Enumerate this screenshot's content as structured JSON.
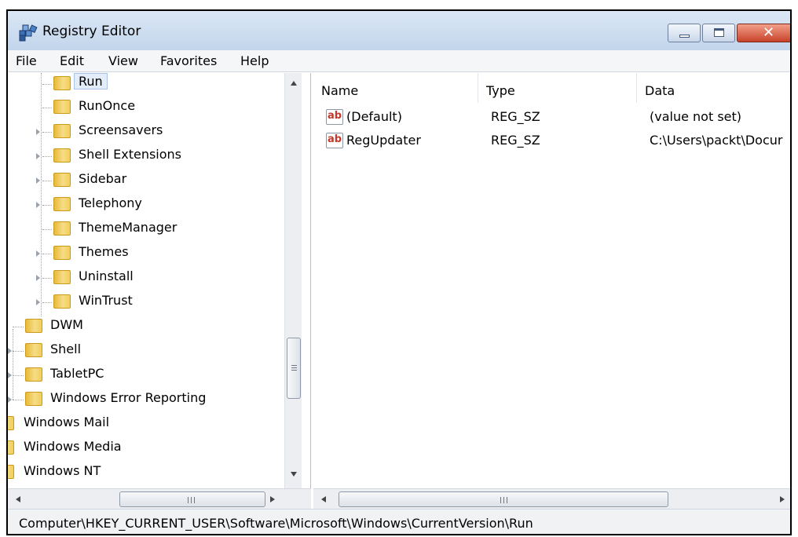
{
  "window": {
    "title": "Registry Editor",
    "close_glyph": "✕",
    "icon": "registry-editor-icon"
  },
  "menu": [
    "File",
    "Edit",
    "View",
    "Favorites",
    "Help"
  ],
  "tree": {
    "items": [
      {
        "label": "Run",
        "selected": true,
        "expandable": false
      },
      {
        "label": "RunOnce",
        "expandable": false
      },
      {
        "label": "Screensavers",
        "expandable": true
      },
      {
        "label": "Shell Extensions",
        "expandable": true
      },
      {
        "label": "Sidebar",
        "expandable": true
      },
      {
        "label": "Telephony",
        "expandable": true
      },
      {
        "label": "ThemeManager",
        "expandable": false
      },
      {
        "label": "Themes",
        "expandable": true
      },
      {
        "label": "Uninstall",
        "expandable": true
      },
      {
        "label": "WinTrust",
        "expandable": true
      },
      {
        "label": "DWM",
        "expandable": false
      },
      {
        "label": "Shell",
        "expandable": true
      },
      {
        "label": "TabletPC",
        "expandable": true
      },
      {
        "label": "Windows Error Reporting",
        "expandable": true
      },
      {
        "label": "Windows Mail",
        "expandable": false
      },
      {
        "label": "Windows Media",
        "expandable": false
      },
      {
        "label": "Windows NT",
        "expandable": false
      }
    ],
    "hscroll_grip": "III"
  },
  "list": {
    "columns": [
      "Name",
      "Type",
      "Data"
    ],
    "rows": [
      {
        "icon": "ab",
        "name": "(Default)",
        "type": "REG_SZ",
        "data": "(value not set)"
      },
      {
        "icon": "ab",
        "name": "RegUpdater",
        "type": "REG_SZ",
        "data": "C:\\Users\\packt\\Docur"
      }
    ],
    "hscroll_grip": "III"
  },
  "status": {
    "path": "Computer\\HKEY_CURRENT_USER\\Software\\Microsoft\\Windows\\CurrentVersion\\Run"
  }
}
